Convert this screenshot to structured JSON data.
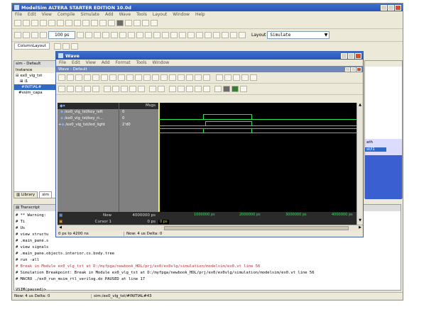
{
  "main": {
    "title": "ModelSim ALTERA STARTER EDITION 10.0d",
    "menus": [
      "File",
      "Edit",
      "View",
      "Compile",
      "Simulate",
      "Add",
      "Wave",
      "Tools",
      "Layout",
      "Window",
      "Help"
    ],
    "run_length": "100 ps",
    "layout_label": "Layout",
    "layout_value": "Simulate",
    "column_layout": "ColumnLayout",
    "sim_title": "sim - Default",
    "instance_header": "Instance",
    "tree": [
      "ex0_vlg_tst",
      "i1",
      "#INITIAL#",
      "#vsim_capa"
    ],
    "tabs": [
      "Library",
      "sim"
    ],
    "objects_cols": [
      "ath"
    ],
    "objects_row": "st/i1"
  },
  "transcript": {
    "title": "Transcript",
    "lines": [
      "# ** Warning:",
      "#            Ti",
      "#            Us",
      "# view structu",
      "# .main_pane.s",
      "# view signals",
      "# .main_pane.objects.interior.cs.body.tree",
      "# run -all",
      "# Break in Module ex0_vlg_tst at D:/myfpga/newbook_HDL/prj/ex0/ex0vlg/simulation/modelsim/ex0.vt line 56",
      "# Simulation Breakpoint: Break in Module ex0_vlg_tst at D:/myfpga/newbook_HDL/prj/ex0/ex0vlg/simulation/modelsim/ex0.vt line 56",
      "# MACRO ./ex0_run_msim_rtl_verilog.do PAUSED at line 17"
    ],
    "prompt": "VSIM(paused)>"
  },
  "status": {
    "now": "Now: 4 us  Delta: 0",
    "path": "sim:/ex0_vlg_tst/#INITIAL#43"
  },
  "wave": {
    "title": "Wave",
    "menus": [
      "File",
      "Edit",
      "View",
      "Add",
      "Format",
      "Tools",
      "Window"
    ],
    "inner_title": "Wave - Default",
    "msgs_header": "Msgs",
    "signals": [
      {
        "name": "/ex0_vlg_tst/key_left",
        "value": "0"
      },
      {
        "name": "/ex0_vlg_tst/key_ri...",
        "value": "0"
      },
      {
        "name": "/ex0_vlg_tst/led_light",
        "value": "2'd0"
      }
    ],
    "now_label": "Now",
    "now_value": "4000000 ps",
    "cursor_label": "Cursor 1",
    "cursor_value": "0 ps",
    "cursor_marker": "0 ps",
    "ticks": [
      "1000000 ps",
      "2000000 ps",
      "3000000 ps",
      "4000000 ps"
    ],
    "range": "0 ps to 4200 ns",
    "status": "Now: 4 us  Delta: 0"
  },
  "colors": {
    "wave_bg": "#000000",
    "signal_green": "#2ce05a",
    "title_blue": "#2a55b3",
    "panel_gray": "#808080"
  }
}
